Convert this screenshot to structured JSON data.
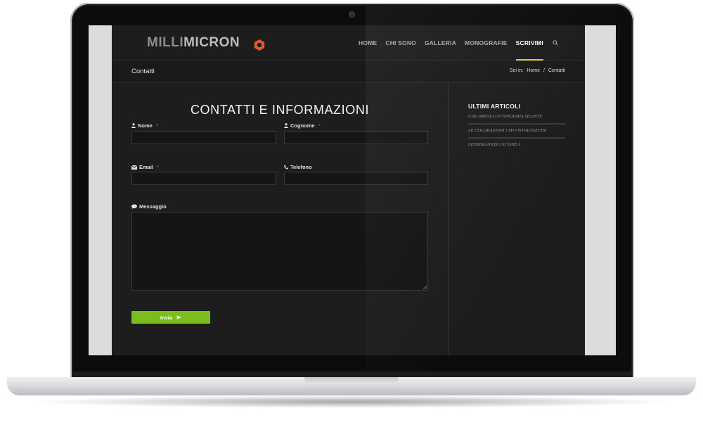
{
  "brand": {
    "name_part1": "MILLI",
    "name_part2": "MICRON",
    "accent": "#e25a2b"
  },
  "nav": {
    "items": [
      {
        "label": "HOME"
      },
      {
        "label": "CHI SONO"
      },
      {
        "label": "GALLERIA"
      },
      {
        "label": "MONOGRAFIE"
      },
      {
        "label": "SCRIVIMI",
        "active": true
      }
    ],
    "search_icon": "search-icon",
    "active_color": "#d8c84a"
  },
  "titlebar": {
    "title": "Contatti",
    "breadcrumb_prefix": "Sei in:",
    "breadcrumb_home": "Home",
    "breadcrumb_sep": "/",
    "breadcrumb_current": "Contatti"
  },
  "form": {
    "title": "CONTATTI E INFORMAZIONI",
    "fields": {
      "nome": {
        "label": "Nome",
        "required": "*",
        "icon": "user-icon",
        "value": ""
      },
      "cognome": {
        "label": "Cognome",
        "required": "*",
        "icon": "user-icon",
        "value": ""
      },
      "email": {
        "label": "Email",
        "required": "*",
        "icon": "envelope-icon",
        "value": ""
      },
      "telefono": {
        "label": "Telefono",
        "icon": "phone-icon",
        "value": ""
      },
      "messaggio": {
        "label": "Messaggio",
        "icon": "comment-icon",
        "value": ""
      }
    },
    "submit_label": "Invia",
    "submit_icon": "send-icon",
    "submit_color": "#7cbd1e"
  },
  "sidebar": {
    "title": "ULTIMI ARTICOLI",
    "articles": [
      {
        "title": "CHLAMYDIA,UN'EPIDEMIA SILENTE"
      },
      {
        "title": "LE COLORAZIONI CITO-ISTOLOGICHE"
      },
      {
        "title": "LEISHMANIOSI CUTANEA"
      }
    ]
  }
}
